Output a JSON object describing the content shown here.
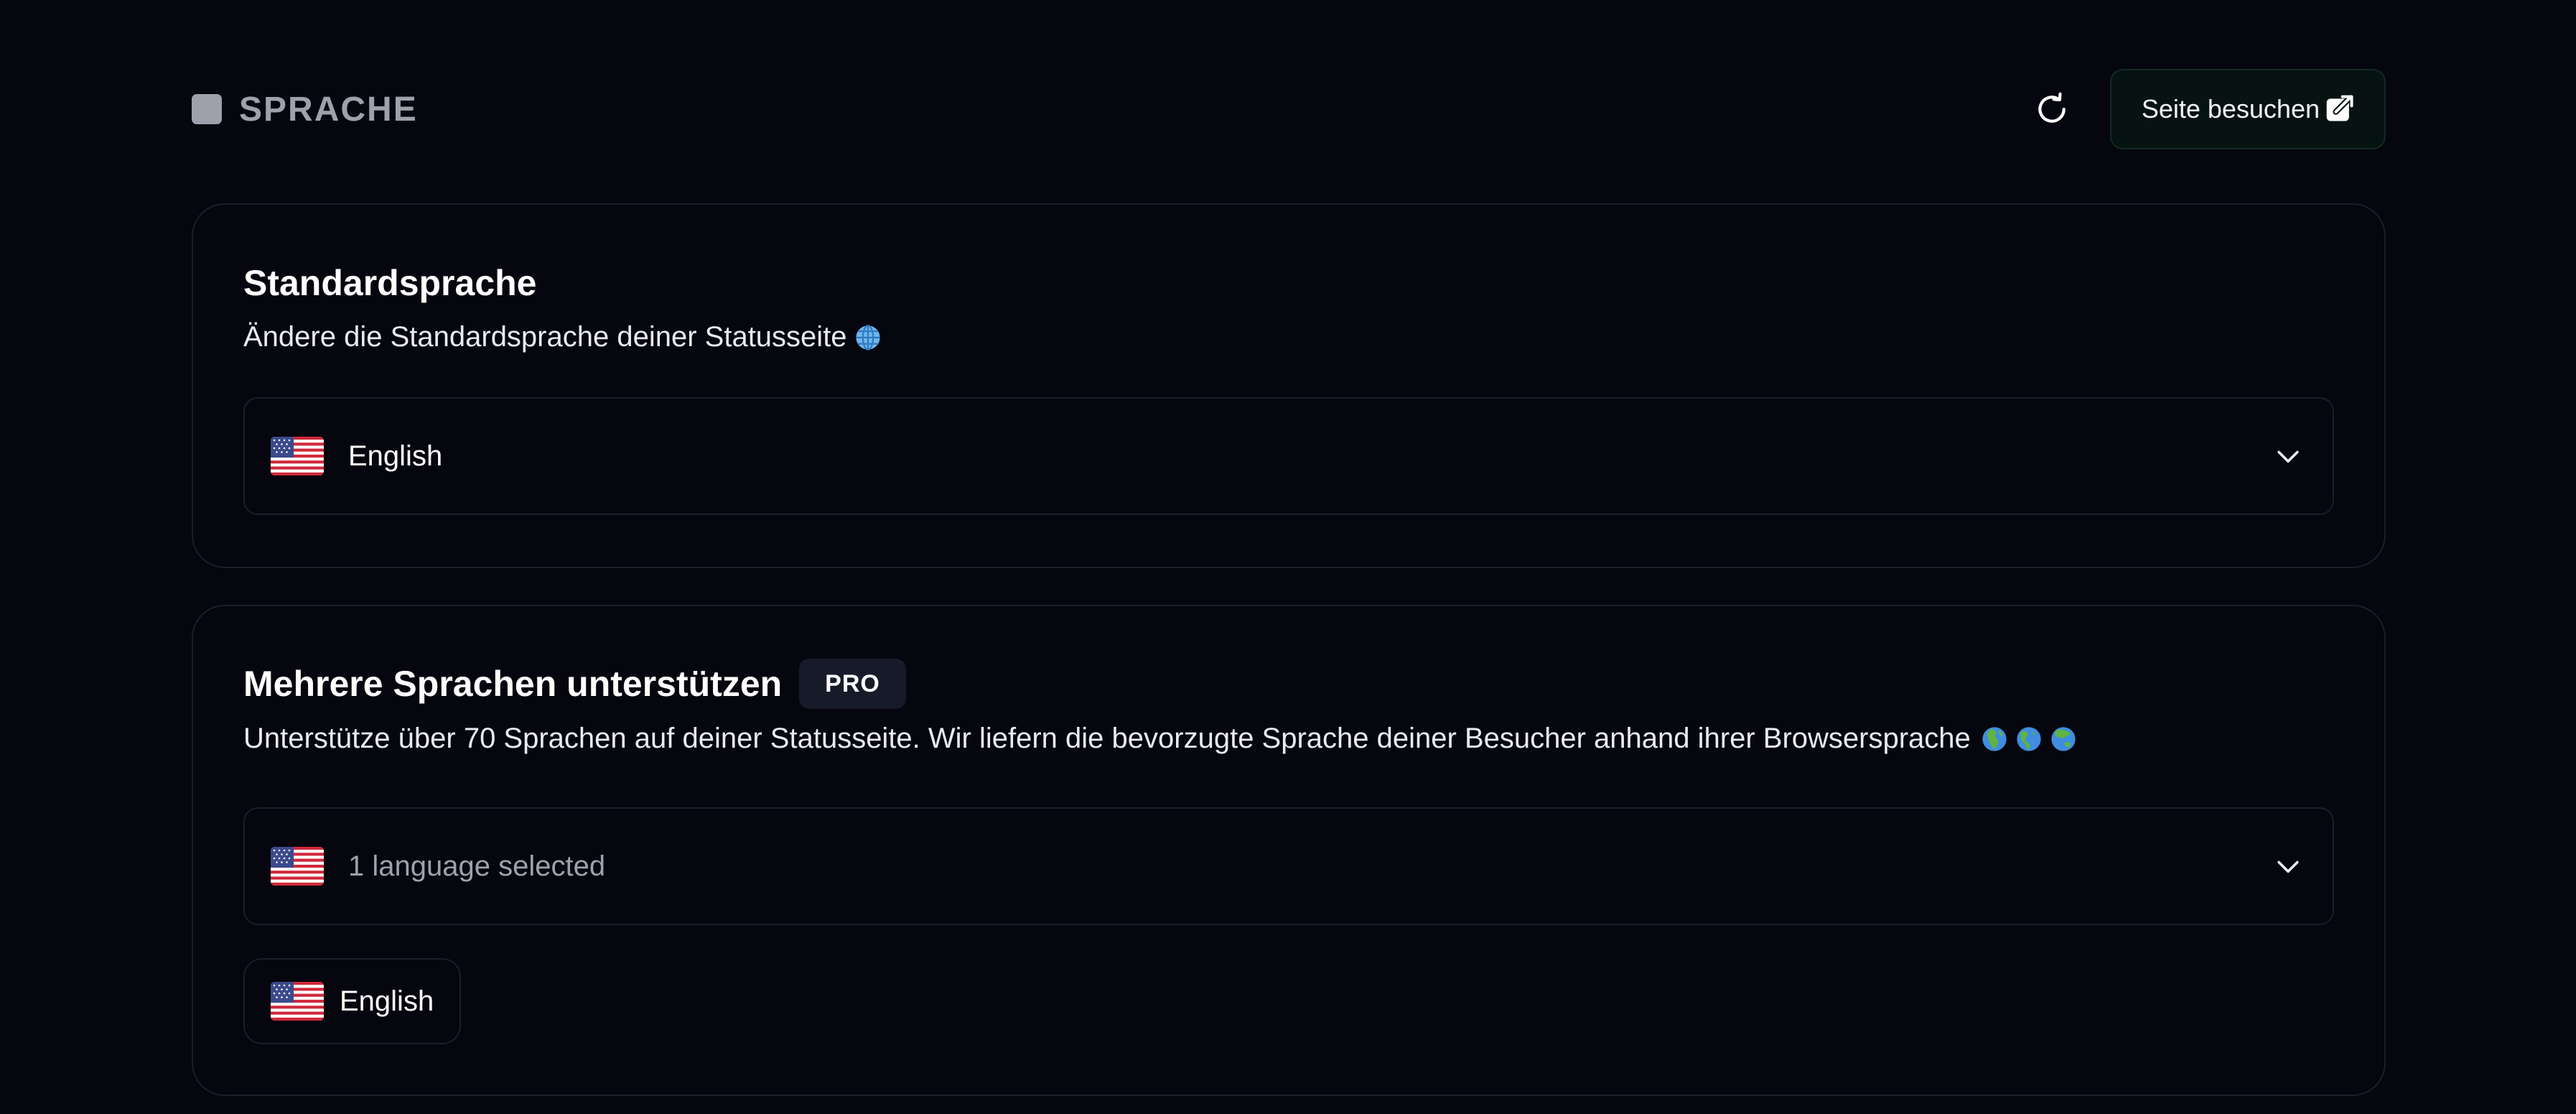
{
  "header": {
    "title": "SPRACHE",
    "visit_label": "Seite besuchen"
  },
  "default_language": {
    "title": "Standardsprache",
    "description": "Ändere die Standardsprache deiner Statusseite",
    "selected": "English",
    "selected_flag": "us-flag-icon"
  },
  "multi_language": {
    "title": "Mehrere Sprachen unterstützen",
    "badge": "PRO",
    "description": "Unterstütze über 70 Sprachen auf deiner Statusseite. Wir liefern die bevorzugte Sprache deiner Besucher anhand ihrer Browsersprache",
    "select_placeholder": "1 language selected",
    "chips": [
      {
        "label": "English",
        "flag": "us-flag-icon"
      }
    ]
  },
  "colors": {
    "background": "#05060e",
    "card_border": "#1b1e2b",
    "muted_text": "#9ea1ab",
    "visit_button_bg": "#071311"
  }
}
